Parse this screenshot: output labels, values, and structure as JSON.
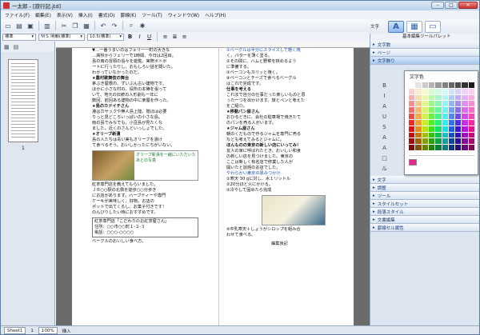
{
  "window": {
    "title": "一太郎 - [旅行記.jtd]",
    "controls": [
      "–",
      "□",
      "✕"
    ]
  },
  "menu": [
    "ファイル(F)",
    "編集(E)",
    "表示(V)",
    "挿入(I)",
    "書式(O)",
    "罫線(K)",
    "ツール(T)",
    "ウィンドウ(W)",
    "ヘルプ(H)"
  ],
  "toolbar": {
    "icons": [
      "new-icon",
      "open-icon",
      "save-icon",
      "print-icon",
      "cut-icon",
      "copy-icon",
      "paste-icon",
      "undo-icon",
      "redo-icon",
      "zoom-icon",
      "help-icon"
    ]
  },
  "mode": {
    "label": "文字",
    "buttons": [
      "A",
      "▦",
      "▭"
    ]
  },
  "format": {
    "style": "標準",
    "font": "ＭＳ 明朝(標準)",
    "size": "10.5(標準)",
    "bold": "B",
    "italic": "I",
    "underline": "U"
  },
  "leftpanel": {
    "page_label": "1"
  },
  "document": {
    "col1": [
      {
        "t": "▼…一番うまいのはフェリー一町の大きな",
        "c": ""
      },
      {
        "t": "…高校からフェリーで1時間、今日は2回目。",
        "c": ""
      },
      {
        "t": "島の南の冒頭の島々を遊覧。実際ボトボ",
        "c": ""
      },
      {
        "t": "ートに行ったりし、おもしろい話を聞いた。",
        "c": ""
      },
      {
        "t": "わかっていなかったのだ。",
        "c": ""
      },
      {
        "t": "★農村歌舞伎の舞台",
        "c": "h"
      },
      {
        "t": "茅ぶき屋根の、ずいぶん古い建物です。",
        "c": ""
      },
      {
        "t": "ほかに小さな村の、役所の本陣を張って",
        "c": ""
      },
      {
        "t": "いて、地元の伝統の人形劇も一年に",
        "c": ""
      },
      {
        "t": "数回、前回ある建物の中に楽屋を作った。",
        "c": ""
      },
      {
        "t": "★島のカドイチさん",
        "c": "h"
      },
      {
        "t": "港はカヤックや無人島上陸、隠ほは必要",
        "c": ""
      },
      {
        "t": "りっと見どころいっぱいの小さな島。",
        "c": ""
      },
      {
        "t": "雨の島でみなでも、小豆島が見たくな",
        "c": ""
      },
      {
        "t": "ました。近くのさんといっしょでした。",
        "c": ""
      },
      {
        "t": "★オリーブ新漬",
        "c": "h"
      },
      {
        "t": "島の人たちは青い実もオリーブを漬け",
        "c": ""
      },
      {
        "t": "て食べるそう。おいしかったにちがいない。",
        "c": ""
      }
    ],
    "photo1_caption": "オリーブ新漬を一緒にいただいたあとの写真",
    "col1b": [
      {
        "t": "紅茶専門店を教えてもらいました。",
        "c": ""
      },
      {
        "t": "ＪＲ○○駅の北側を徒歩○○分歩き",
        "c": ""
      },
      {
        "t": "にお店があります。ハーブティーや専門",
        "c": ""
      },
      {
        "t": "ケーキが美味しく、好物。お店の",
        "c": ""
      },
      {
        "t": "ポットで出てくるし、お菓子付きです！",
        "c": ""
      },
      {
        "t": "のんびりしたい時におすすめです。",
        "c": ""
      }
    ],
    "shop": {
      "name": "紅茶専門店「こだわりのお紅茶屋さん」",
      "addr": "住所：○○市○○町１-２-３",
      "tel": "電話：○○○-○○○○"
    },
    "col1c": "ベーグルのおいしい食べ方。",
    "col2": [
      {
        "t": "①ベーグルは半分にスライスして軽く焼",
        "c": "blue"
      },
      {
        "t": "く。バターを薄く塗る。",
        "c": ""
      },
      {
        "t": "②その間に、ハムと野菜を挟めるよう",
        "c": ""
      },
      {
        "t": "に準備する。",
        "c": ""
      },
      {
        "t": "③ベーコンもカリッと焼く。",
        "c": ""
      },
      {
        "t": "④ベーコンとチーズで食べるベーグル",
        "c": ""
      },
      {
        "t": "はこれで完成です。",
        "c": ""
      },
      {
        "t": "仕事を考える",
        "c": "h"
      },
      {
        "t": "これまで自分の仕事だった楽しいものと思",
        "c": ""
      },
      {
        "t": "った一つを出かけます。旅とペンと考えた",
        "c": ""
      },
      {
        "t": "をご紹介。",
        "c": ""
      },
      {
        "t": "★移動パン屋さん",
        "c": "h"
      },
      {
        "t": "おひるどきに、会社の駐車場で焼きたて",
        "c": ""
      },
      {
        "t": "のパンを売る人がいます。",
        "c": ""
      },
      {
        "t": "★ジャム屋さん",
        "c": "h"
      },
      {
        "t": "朝のくだもので作るジャムを専門に売る",
        "c": ""
      },
      {
        "t": "なども考えてみるとジャムに。",
        "c": ""
      },
      {
        "t": "ほんものの東京の新しい店にいってみ！",
        "c": "h"
      },
      {
        "t": "友人の家に呼ばれたとき、おいしい和食",
        "c": ""
      },
      {
        "t": "の新しい店を見つけました。東京の",
        "c": ""
      },
      {
        "t": "ここは新しく有名店で修業した人が",
        "c": ""
      },
      {
        "t": "開いたと話題のお店でした。",
        "c": ""
      },
      {
        "t": "やわらかい東京の黒みつかけ",
        "c": "blue"
      },
      {
        "t": "①寒天 30 gに対し、水１リットル",
        "c": ""
      },
      {
        "t": "②20分ほど火にかける。",
        "c": ""
      },
      {
        "t": "③冷やして固めたら完成",
        "c": ""
      }
    ],
    "col2b": [
      {
        "t": "※中乳寒天＋しょうがシロップを組み合",
        "c": ""
      },
      {
        "t": "わせて食べる。",
        "c": ""
      }
    ],
    "col2c": "編集後記"
  },
  "rightpanel": {
    "title": "基本編集ツールパレット",
    "sections_top": [
      "文字数",
      "ページ",
      "文字飾り"
    ],
    "color_popup": {
      "title": "文字色"
    },
    "sections_bottom": [
      "文字",
      "調整",
      "ツール",
      "スタイルセット",
      "段落スタイル",
      "文書編集",
      "罫線セル属性"
    ],
    "side_icons": [
      "bold-icon",
      "italic-icon",
      "font-color-icon",
      "underline-icon",
      "strikethrough-icon",
      "shadow-icon",
      "outline-icon",
      "boxed-char-icon",
      "ruby-icon",
      "emphasis-icon",
      "dotted-icon"
    ]
  },
  "statusbar": {
    "sheet": "Sheet1",
    "page": "1",
    "zoom": "100%",
    "mode": "挿入"
  }
}
